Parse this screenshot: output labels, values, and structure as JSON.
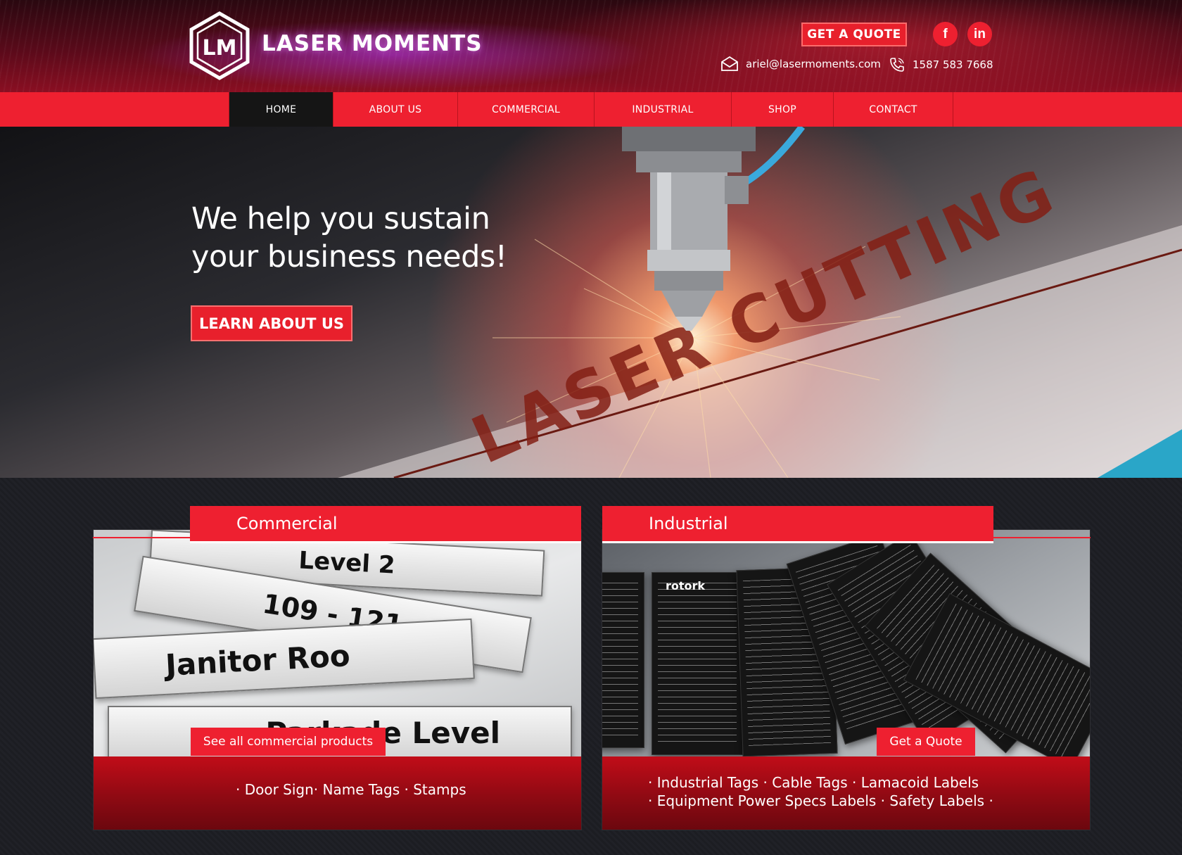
{
  "header": {
    "brand": "LASER MOMENTS",
    "logo_letters": "LM",
    "quote_button": "GET A QUOTE",
    "social": {
      "facebook": "f",
      "linkedin": "in"
    },
    "email": "ariel@lasermoments.com",
    "phone": "1587 583 7668"
  },
  "nav": {
    "items": [
      {
        "label": "HOME",
        "active": true
      },
      {
        "label": "ABOUT US"
      },
      {
        "label": "COMMERCIAL"
      },
      {
        "label": "INDUSTRIAL"
      },
      {
        "label": "SHOP"
      },
      {
        "label": "CONTACT"
      }
    ]
  },
  "hero": {
    "title_line1": "We help you sustain",
    "title_line2": "your business needs!",
    "button": "LEARN ABOUT US",
    "image_text": "LASER CUTTING"
  },
  "commercial": {
    "title": "Commercial",
    "button": "See all commercial products",
    "description": "· Door Sign· Name Tags · Stamps",
    "signs": [
      "Level 2",
      "109 - 121",
      "Janitor Roo",
      "Parkade Level"
    ]
  },
  "industrial": {
    "title": "Industrial",
    "button": "Get a Quote",
    "description_line1": "· Industrial Tags · Cable Tags · Lamacoid Labels",
    "description_line2": "· Equipment Power Specs Labels · Safety Labels ·",
    "tag_brand": "rotork"
  },
  "colors": {
    "accent_red": "#ee2030",
    "nav_active": "#151515",
    "page_bg": "#1b1c21"
  }
}
